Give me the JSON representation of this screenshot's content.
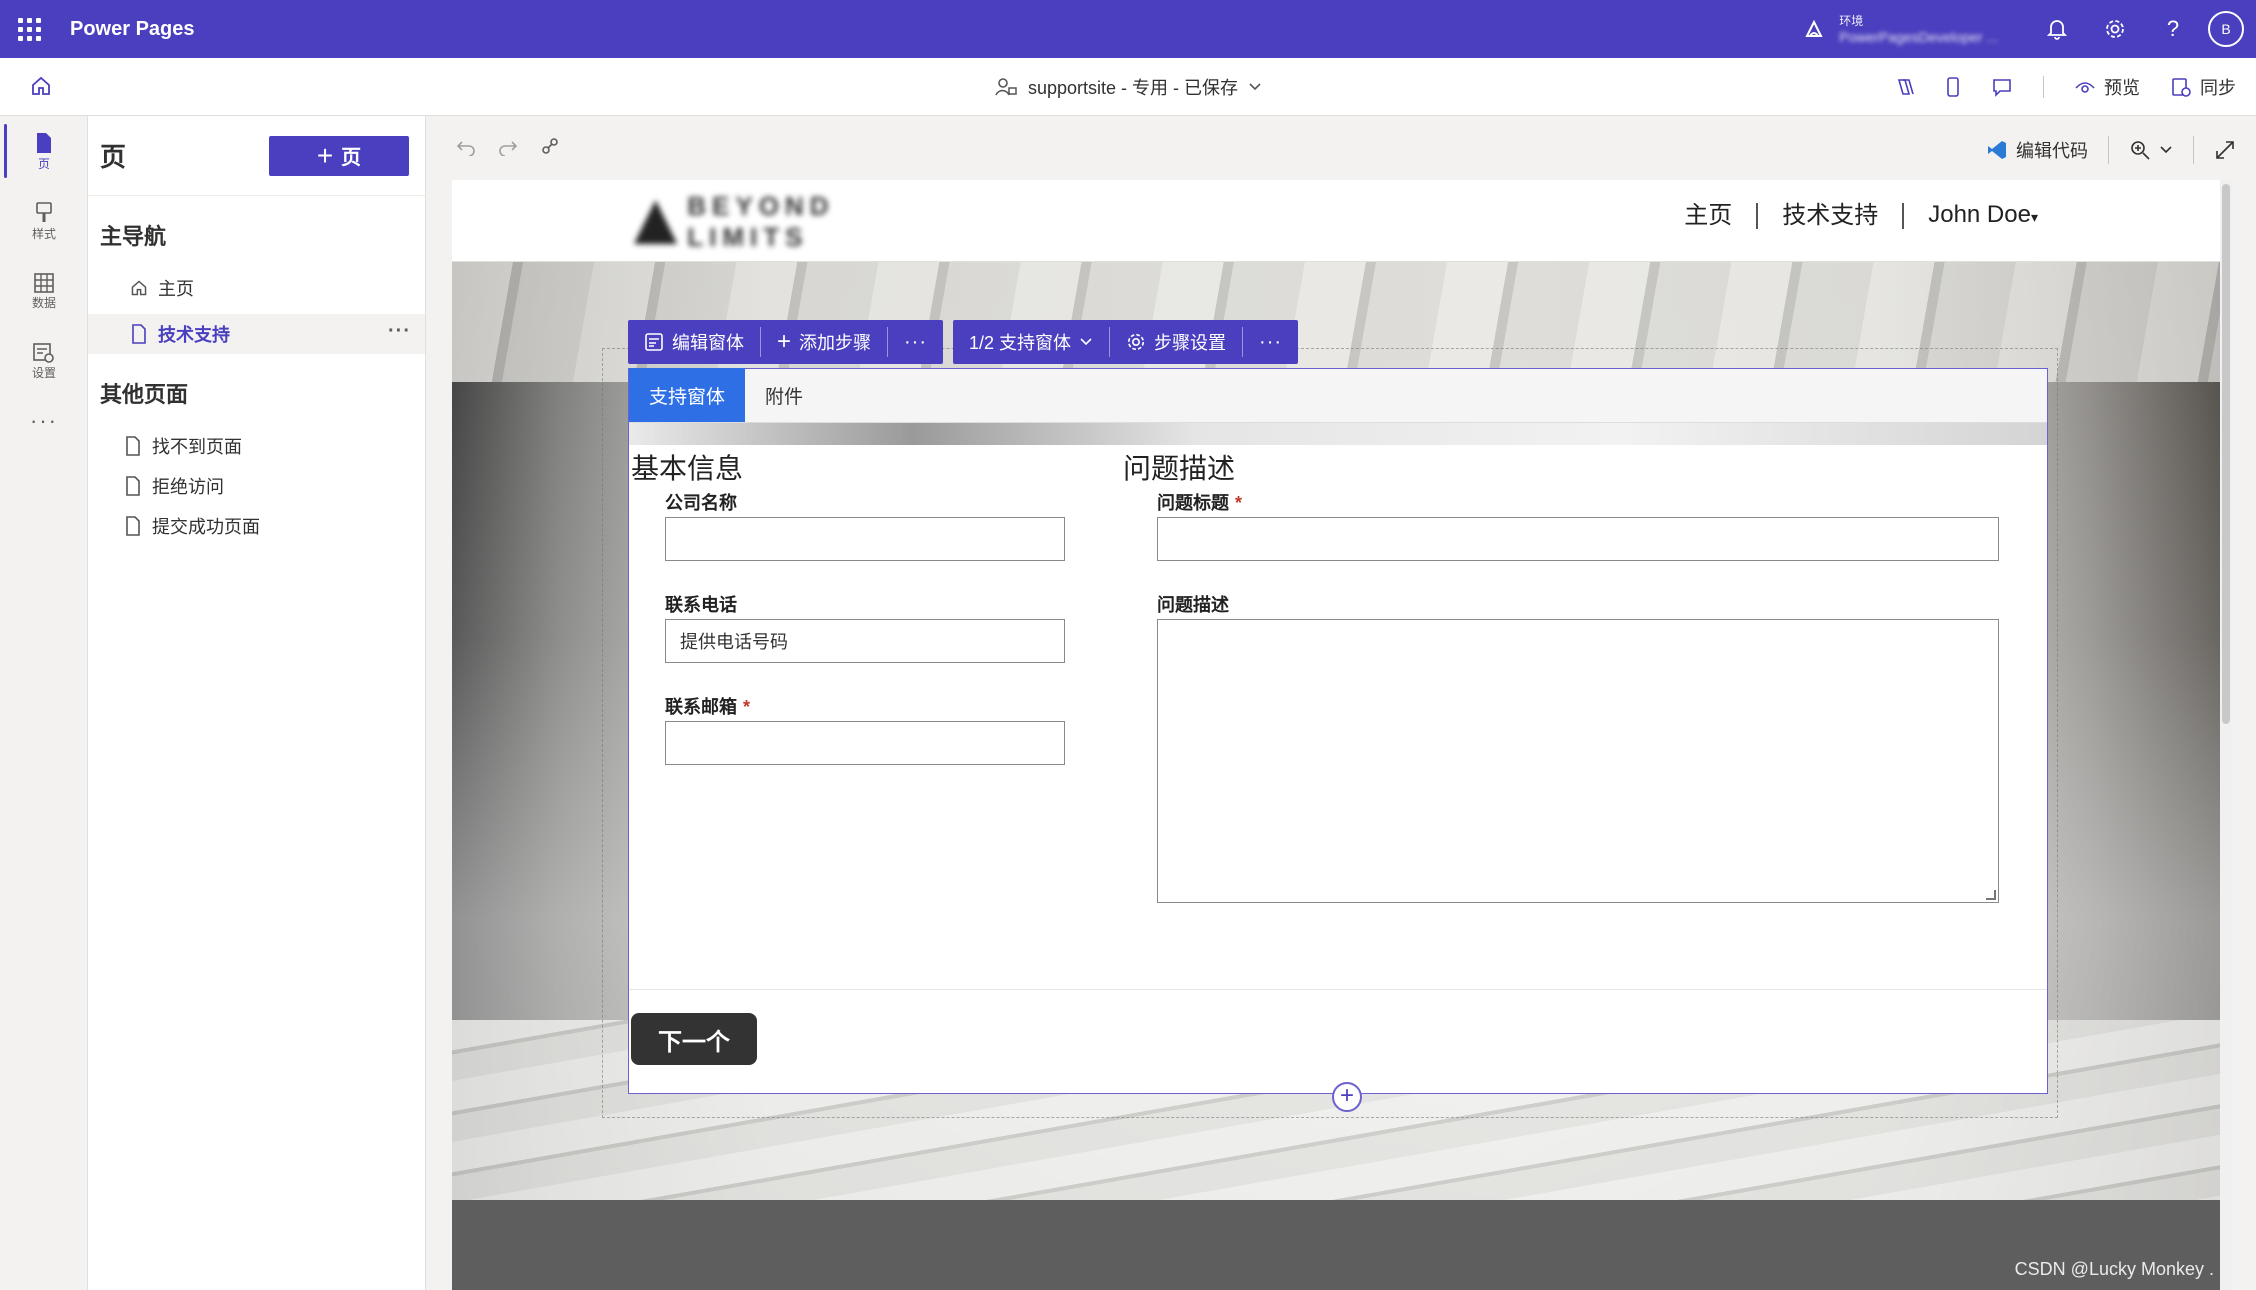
{
  "app": {
    "name": "Power Pages"
  },
  "topbar": {
    "env_label": "环境",
    "env_name": "PowerPagesDeveloper ...",
    "avatar_initial": "B"
  },
  "subbar": {
    "site_title": "supportsite - 专用 - 已保存",
    "preview_label": "预览",
    "sync_label": "同步"
  },
  "rail": {
    "items": [
      {
        "label": "页",
        "icon": "page-icon"
      },
      {
        "label": "样式",
        "icon": "brush-icon"
      },
      {
        "label": "数据",
        "icon": "table-icon"
      },
      {
        "label": "设置",
        "icon": "settings-icon"
      }
    ],
    "more": "···"
  },
  "panel": {
    "title": "页",
    "add_button": "页",
    "main_nav_title": "主导航",
    "main_nav": [
      {
        "label": "主页",
        "icon": "home-icon"
      },
      {
        "label": "技术支持",
        "icon": "page-icon",
        "active": true
      }
    ],
    "other_title": "其他页面",
    "other_pages": [
      {
        "label": "找不到页面"
      },
      {
        "label": "拒绝访问"
      },
      {
        "label": "提交成功页面"
      }
    ],
    "more": "···"
  },
  "canvas_toolbar": {
    "edit_code": "编辑代码"
  },
  "site": {
    "logo_text": "BEYOND LIMITS",
    "nav": [
      "主页",
      "技术支持",
      "John Doe"
    ]
  },
  "form_toolbar": {
    "edit_form": "编辑窗体",
    "add_step": "添加步骤",
    "more": "···",
    "step_selector": "1/2 支持窗体",
    "step_settings": "步骤设置"
  },
  "form": {
    "tabs": [
      "支持窗体",
      "附件"
    ],
    "section_left": "基本信息",
    "section_right": "问题描述",
    "fields": {
      "company": {
        "label": "公司名称",
        "value": ""
      },
      "phone": {
        "label": "联系电话",
        "value": "提供电话号码"
      },
      "email": {
        "label": "联系邮箱",
        "required": "*",
        "value": ""
      },
      "issue_title": {
        "label": "问题标题",
        "required": "*",
        "value": ""
      },
      "issue_desc": {
        "label": "问题描述",
        "value": ""
      }
    },
    "next_button": "下一个",
    "add_symbol": "+"
  },
  "watermark": "CSDN @Lucky Monkey .",
  "colors": {
    "brand": "#4a3fbe",
    "tab_active": "#2e6fe6",
    "required": "#c0392b"
  }
}
